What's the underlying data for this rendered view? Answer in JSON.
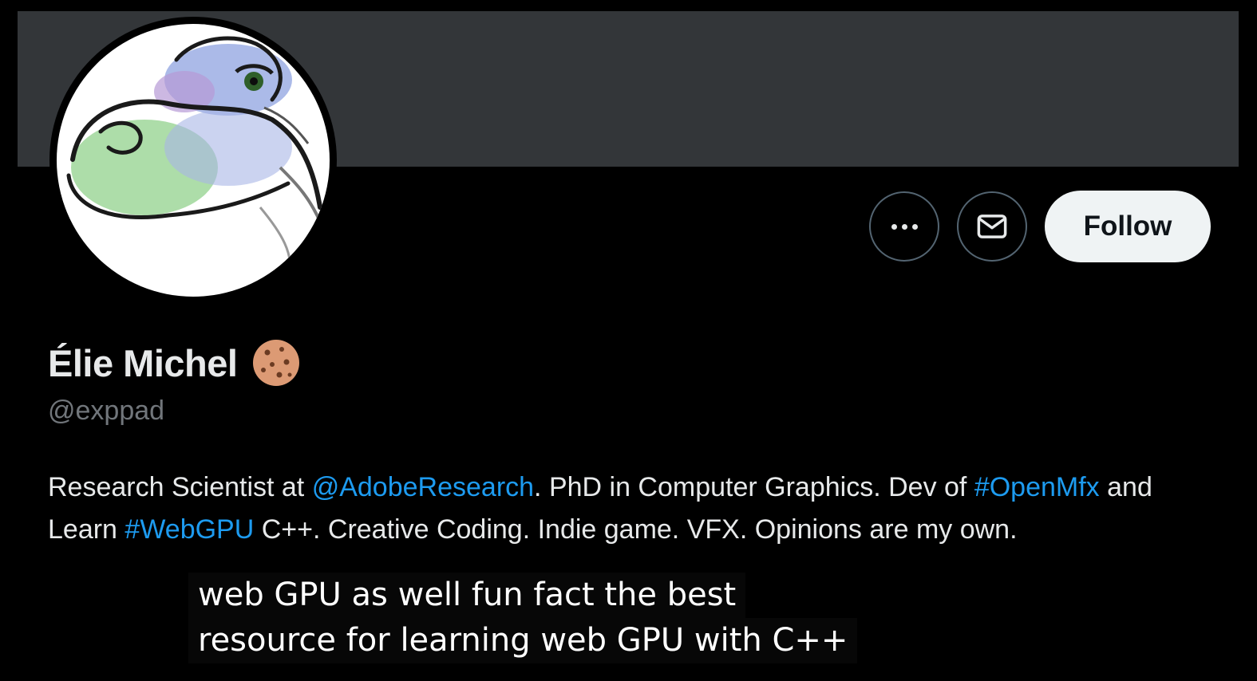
{
  "profile": {
    "display_name": "Élie Michel",
    "name_emoji": "cookie-emoji-icon",
    "handle": "@exppad",
    "bio": {
      "part1": "Research Scientist at ",
      "mention": "@AdobeResearch",
      "part2": ". PhD in Computer Graphics. Dev of ",
      "hashtag1": "#OpenMfx",
      "part3": " and Learn ",
      "hashtag2": "#WebGPU",
      "part4": " C++. Creative Coding. Indie game. VFX. Opinions are my own."
    }
  },
  "actions": {
    "more_icon": "more-dots-icon",
    "message_icon": "envelope-icon",
    "follow_label": "Follow"
  },
  "caption": {
    "line1": "web GPU as well fun fact the best",
    "line2": "resource for learning web GPU with C++"
  },
  "colors": {
    "background": "#000000",
    "banner": "#333639",
    "link": "#1d9bf0",
    "text": "#e7e9ea",
    "secondary_text": "#71767b",
    "follow_button": "#eff3f4"
  }
}
